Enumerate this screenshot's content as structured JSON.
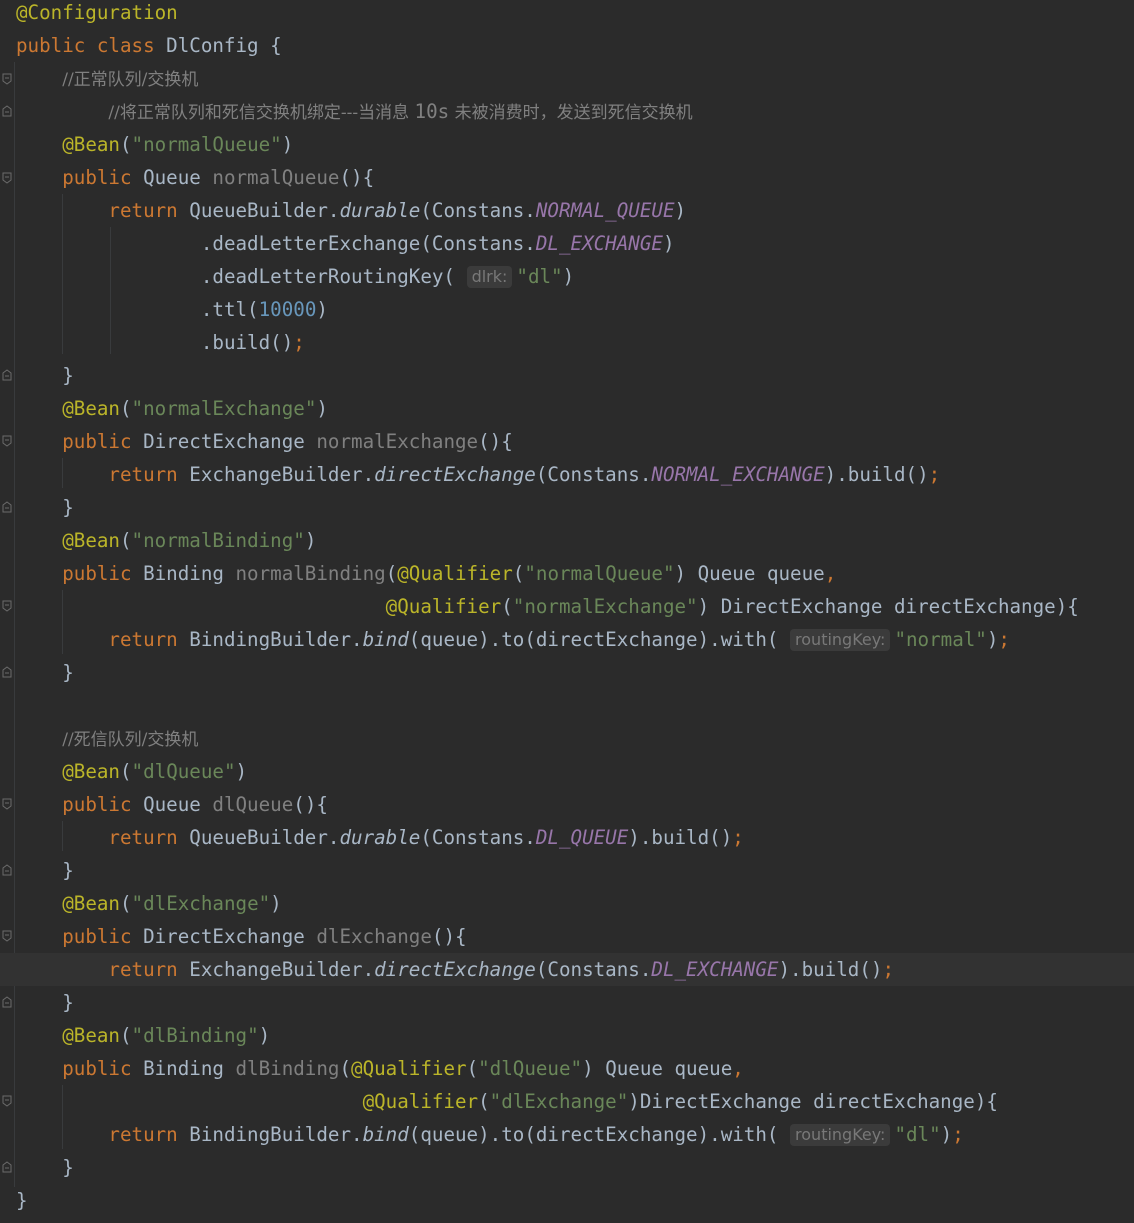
{
  "editor": {
    "theme": "darcula",
    "colors": {
      "background": "#2b2b2b",
      "keyword": "#cc7832",
      "annotation": "#bbb529",
      "string": "#6a8759",
      "comment": "#808080",
      "constant": "#9876aa",
      "number": "#6897bb",
      "text": "#a9b7c6"
    },
    "fold_icon": "fold-marker-icon"
  },
  "code": {
    "l1": {
      "ann": "@Configuration"
    },
    "l2": {
      "kw": "public class",
      "cls": " DlConfig {"
    },
    "l3": {
      "comment": "//正常队列/交换机"
    },
    "l4": {
      "comment_a": "//将正常队列和死信交换机绑定---当消息 ",
      "comment_mono": "10s",
      "comment_b": " 未被消费时，发送到死信交换机"
    },
    "l5": {
      "ann": "@Bean",
      "p1": "(",
      "str": "\"normalQueue\"",
      "p2": ")"
    },
    "l6": {
      "kw": "public",
      "type": " Queue ",
      "name": "normalQueue",
      "rest": "(){"
    },
    "l7": {
      "kw": "return",
      "a": " QueueBuilder.",
      "fn": "durable",
      "b": "(Constans.",
      "konst": "NORMAL_QUEUE",
      "c": ")"
    },
    "l8": {
      "a": ".deadLetterExchange(Constans.",
      "konst": "DL_EXCHANGE",
      "c": ")"
    },
    "l9": {
      "a": ".deadLetterRoutingKey(",
      "hint": "dlrk:",
      "str": "\"dl\"",
      "c": ")"
    },
    "l10": {
      "a": ".ttl(",
      "num": "10000",
      "c": ")"
    },
    "l11": {
      "a": ".build()",
      "semi": ";"
    },
    "l12": {
      "brace": "}"
    },
    "l13": {
      "ann": "@Bean",
      "p1": "(",
      "str": "\"normalExchange\"",
      "p2": ")"
    },
    "l14": {
      "kw": "public",
      "type": " DirectExchange ",
      "name": "normalExchange",
      "rest": "(){"
    },
    "l15": {
      "kw": "return",
      "a": " ExchangeBuilder.",
      "fn": "directExchange",
      "b": "(Constans.",
      "konst": "NORMAL_EXCHANGE",
      "c": ").build()",
      "semi": ";"
    },
    "l16": {
      "brace": "}"
    },
    "l17": {
      "ann": "@Bean",
      "p1": "(",
      "str": "\"normalBinding\"",
      "p2": ")"
    },
    "l18": {
      "kw": "public",
      "type": " Binding ",
      "name": "normalBinding",
      "p": "(",
      "ann": "@Qualifier",
      "p1": "(",
      "str": "\"normalQueue\"",
      "rest": ") Queue queue",
      "comma": ","
    },
    "l19": {
      "ann": "@Qualifier",
      "p1": "(",
      "str": "\"normalExchange\"",
      "rest": ") DirectExchange directExchange){"
    },
    "l20": {
      "kw": "return",
      "a": " BindingBuilder.",
      "fn": "bind",
      "b": "(queue).to(directExchange).with(",
      "hint": "routingKey:",
      "str": "\"normal\"",
      "c": ")",
      "semi": ";"
    },
    "l21": {
      "brace": "}"
    },
    "l23": {
      "comment": "//死信队列/交换机"
    },
    "l24": {
      "ann": "@Bean",
      "p1": "(",
      "str": "\"dlQueue\"",
      "p2": ")"
    },
    "l25": {
      "kw": "public",
      "type": " Queue ",
      "name": "dlQueue",
      "rest": "(){"
    },
    "l26": {
      "kw": "return",
      "a": " QueueBuilder.",
      "fn": "durable",
      "b": "(Constans.",
      "konst": "DL_QUEUE",
      "c": ").build()",
      "semi": ";"
    },
    "l27": {
      "brace": "}"
    },
    "l28": {
      "ann": "@Bean",
      "p1": "(",
      "str": "\"dlExchange\"",
      "p2": ")"
    },
    "l29": {
      "kw": "public",
      "type": " DirectExchange ",
      "name": "dlExchange",
      "rest": "(){"
    },
    "l30": {
      "kw": "return",
      "a": " ExchangeBuilder.",
      "fn": "directExchange",
      "b": "(Constans.",
      "konst": "DL_EXCHANGE",
      "c": ").build()",
      "semi": ";"
    },
    "l31": {
      "brace": "}"
    },
    "l32": {
      "ann": "@Bean",
      "p1": "(",
      "str": "\"dlBinding\"",
      "p2": ")"
    },
    "l33": {
      "kw": "public",
      "type": " Binding ",
      "name": "dlBinding",
      "p": "(",
      "ann": "@Qualifier",
      "p1": "(",
      "str": "\"dlQueue\"",
      "rest": ") Queue queue",
      "comma": ","
    },
    "l34": {
      "ann": "@Qualifier",
      "p1": "(",
      "str": "\"dlExchange\"",
      "rest": ")DirectExchange directExchange){"
    },
    "l35": {
      "kw": "return",
      "a": " BindingBuilder.",
      "fn": "bind",
      "b": "(queue).to(directExchange).with(",
      "hint": "routingKey:",
      "str": "\"dl\"",
      "c": ")",
      "semi": ";"
    },
    "l36": {
      "brace": "}"
    },
    "l37": {
      "brace": "}"
    }
  }
}
